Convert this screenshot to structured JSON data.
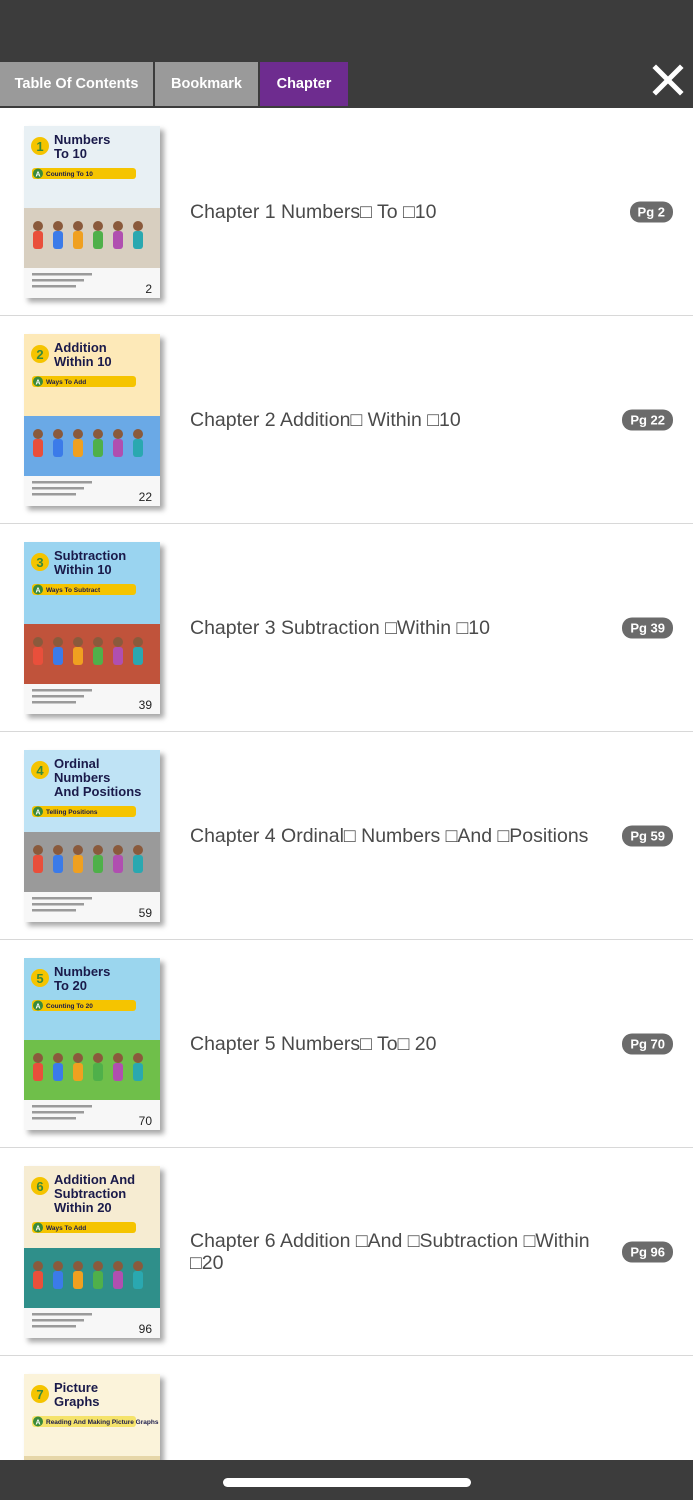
{
  "tabs": {
    "toc_label": "Table Of Contents",
    "bookmark_label": "Bookmark",
    "chapter_label": "Chapter"
  },
  "icons": {
    "close": "close-icon"
  },
  "colors": {
    "header_bg": "#3c3c3c",
    "tab_inactive": "#9a9a9a",
    "tab_active": "#6e2c8f",
    "badge_bg": "#6b6b6b"
  },
  "chapters": [
    {
      "title": "Chapter 1 Numbers□ To □10",
      "page_badge": "Pg 2",
      "cover": {
        "number": "1",
        "title_lines": [
          "Numbers",
          "To 10"
        ],
        "lesson_letter": "A",
        "lesson": "Counting To 10",
        "page_number": "2",
        "sky": "#e8f0f4",
        "ground": "#d8cfc0",
        "banner": "#f5c400",
        "badge": "#f5c400"
      }
    },
    {
      "title": "Chapter 2 Addition□ Within □10",
      "page_badge": "Pg 22",
      "cover": {
        "number": "2",
        "title_lines": [
          "Addition",
          "Within 10"
        ],
        "lesson_letter": "A",
        "lesson": "Ways To Add",
        "page_number": "22",
        "sky": "#fde9b8",
        "ground": "#6aa9e6",
        "banner": "#f5c400",
        "badge": "#f5c400"
      }
    },
    {
      "title": "Chapter 3 Subtraction □Within □10",
      "page_badge": "Pg 39",
      "cover": {
        "number": "3",
        "title_lines": [
          "Subtraction",
          "Within 10"
        ],
        "lesson_letter": "A",
        "lesson": "Ways To Subtract",
        "page_number": "39",
        "sky": "#9ad4f0",
        "ground": "#c0533b",
        "banner": "#f5c400",
        "badge": "#f5c400"
      }
    },
    {
      "title": "Chapter 4 Ordinal□ Numbers □And □Positions",
      "page_badge": "Pg 59",
      "cover": {
        "number": "4",
        "title_lines": [
          "Ordinal",
          "Numbers",
          "And Positions"
        ],
        "lesson_letter": "A",
        "lesson": "Telling Positions",
        "page_number": "59",
        "sky": "#bfe3f5",
        "ground": "#9a9a9a",
        "banner": "#f5c400",
        "badge": "#f5c400"
      }
    },
    {
      "title": "Chapter 5 Numbers□ To□ 20",
      "page_badge": "Pg 70",
      "cover": {
        "number": "5",
        "title_lines": [
          "Numbers",
          "To 20"
        ],
        "lesson_letter": "A",
        "lesson": "Counting To 20",
        "page_number": "70",
        "sky": "#9bd6ee",
        "ground": "#6fbf4a",
        "banner": "#f5c400",
        "badge": "#f5c400"
      }
    },
    {
      "title": "Chapter 6 Addition □And □Subtraction □Within □20",
      "page_badge": "Pg 96",
      "cover": {
        "number": "6",
        "title_lines": [
          "Addition And",
          "Subtraction",
          "Within 20"
        ],
        "lesson_letter": "A",
        "lesson": "Ways To Add",
        "page_number": "96",
        "sky": "#f6ecd2",
        "ground": "#2f8f8a",
        "banner": "#f5c400",
        "badge": "#f5c400"
      }
    },
    {
      "title": "",
      "page_badge": "",
      "cover": {
        "number": "7",
        "title_lines": [
          "Picture",
          "Graphs"
        ],
        "lesson_letter": "A",
        "lesson": "Reading And Making Picture Graphs",
        "page_number": "",
        "sky": "#fbf3da",
        "ground": "#e6d6a8",
        "banner": "#f5e36a",
        "badge": "#f5c400"
      }
    }
  ]
}
